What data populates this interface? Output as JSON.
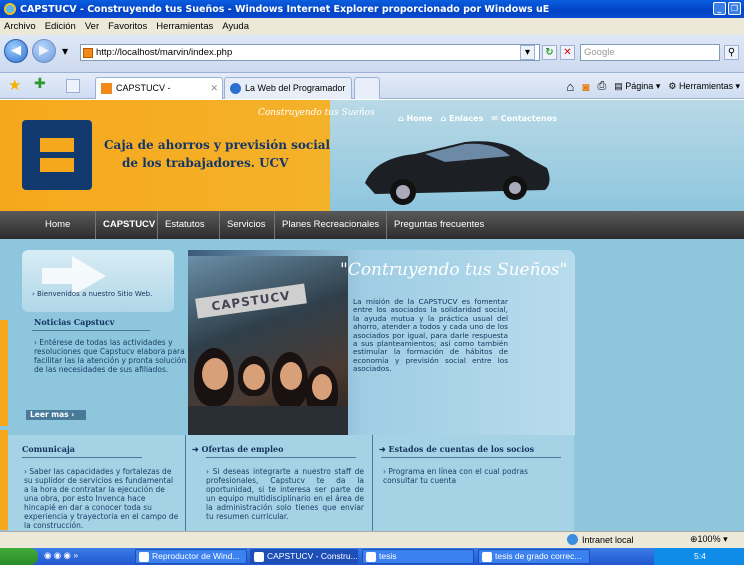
{
  "window": {
    "title": "CAPSTUCV - Construyendo tus Sueños - Windows Internet Explorer proporcionado por Windows uE"
  },
  "menu": [
    "Archivo",
    "Edición",
    "Ver",
    "Favoritos",
    "Herramientas",
    "Ayuda"
  ],
  "address": {
    "url": "http://localhost/marvin/index.php",
    "search_placeholder": "Google"
  },
  "tabs": [
    {
      "label": "CAPSTUCV - Construyen..."
    },
    {
      "label": "La Web del Programador"
    }
  ],
  "toolbar_right": {
    "page_label": "Página",
    "tools_label": "Herramientas"
  },
  "site": {
    "org_line1": "Caja de ahorros y previsión social",
    "org_line2": "de los trabajadores. UCV",
    "slogan_top": "Construyendo tus Sueños",
    "toplinks": [
      "Home",
      "Enlaces",
      "Contactenos"
    ],
    "nav": [
      "Home",
      "CAPSTUCV",
      "Estatutos",
      "Servicios",
      "Planes Recreacionales",
      "Preguntas frecuentes"
    ],
    "welcome": "Bienvenidos a nuestro Sitio Web.",
    "photo_sign": "CAPSTUCV",
    "news_title": "Noticias Capstucv",
    "news_body": "Entérese de todas las actividades y resoluciones que Capstucv elabora para facilitar las la atención y pronta solución de las necesidades de sus afiliados.",
    "read_more": "Leer mas",
    "feature_title": "\"Contruyendo tus Sueños\"",
    "feature_body": "La misión de la CAPSTUCV es fomentar entre los asociados la solidaridad social, la ayuda mutua y la práctica usual del ahorro, atender a todos y cada uno de los asociados por igual, para darle respuesta a sus planteamientos; así como también estimular la formación de hábitos de economía y previsión social entre los asociados.",
    "bottom": [
      {
        "title": "Comunicaja",
        "body": "Saber las capacidades y fortalezas de su suplidor de servicios es fundamental a la hora de contratar la ejecución de una obra, por esto Invenca hace hincapié en dar a conocer toda su experiencia y trayectoria en el campo de la construcción."
      },
      {
        "title": "Ofertas de empleo",
        "body": "Si deseas integrarte a nuestro staff de profesionales, Capstucv te da la oportunidad, si te interesa ser parte de un equipo multidisciplinario en el área de la administración solo tienes que enviar tu resumen curricular."
      },
      {
        "title": "Estados de cuentas de los socios",
        "body": "Programa en línea con el cual podras consultar tu cuenta"
      }
    ]
  },
  "status": {
    "zone": "Intranet local",
    "zoom": "100%"
  },
  "taskbar": {
    "items": [
      "Reproductor de Wind...",
      "CAPSTUCV - Constru...",
      "tesis",
      "tesis de grado correc..."
    ],
    "clock": "5:4"
  }
}
